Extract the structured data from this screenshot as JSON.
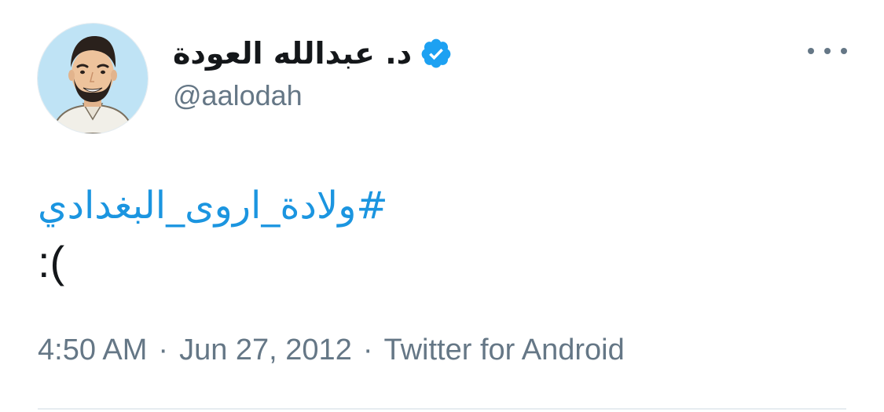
{
  "tweet": {
    "author": {
      "display_name": "د. عبدالله العودة",
      "handle": "@aalodah",
      "verified": true
    },
    "text": {
      "hashtag": "#ولادة_اروى_البغدادي",
      "emoticon": ":("
    },
    "meta": {
      "time": "4:50 AM",
      "separator": "·",
      "date": "Jun 27, 2012",
      "source": "Twitter for Android"
    }
  },
  "icons": {
    "more": "more-horizontal-icon",
    "verified": "verified-badge-icon"
  },
  "colors": {
    "link": "#1b95e0",
    "muted": "#657786",
    "verified_badge": "#1da1f2",
    "avatar_background": "#bfe3f5"
  }
}
